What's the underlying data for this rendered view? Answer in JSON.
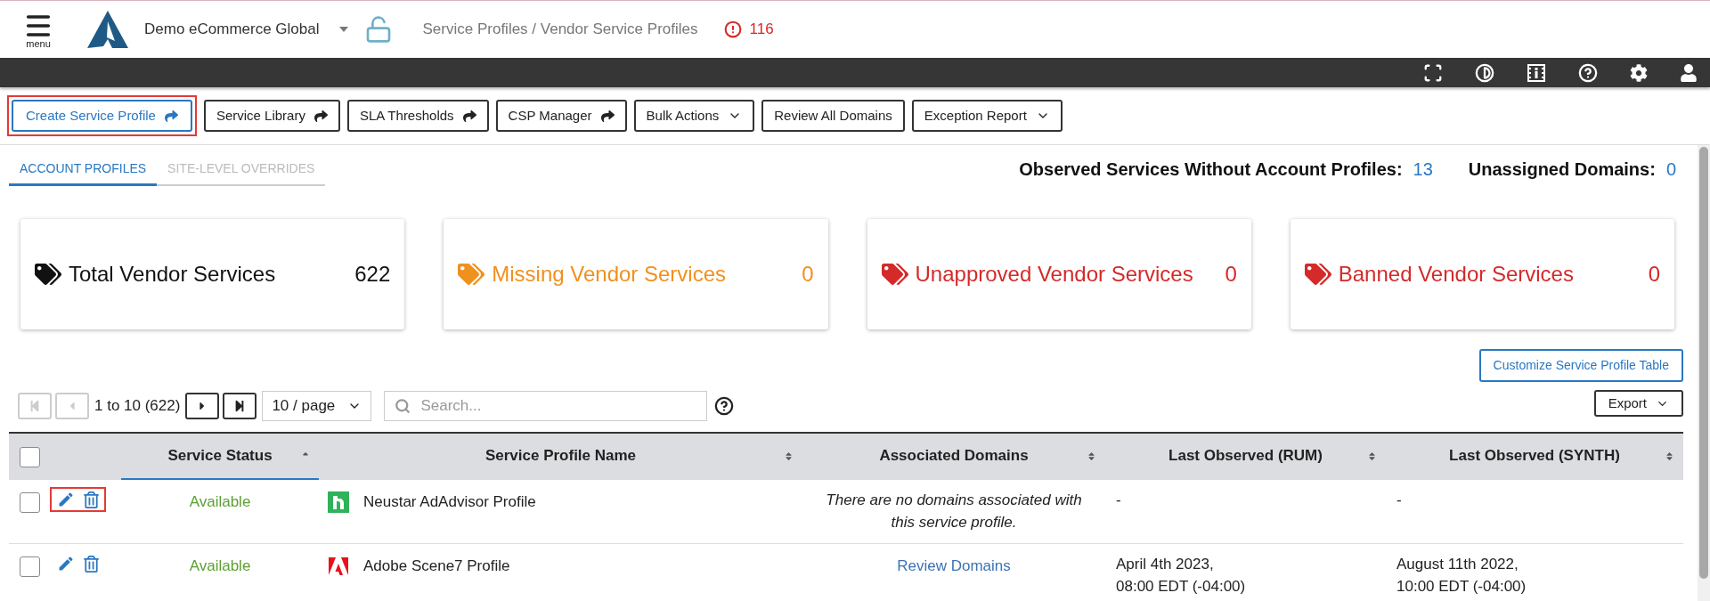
{
  "header": {
    "menu_label": "menu",
    "org_name": "Demo eCommerce Global",
    "breadcrumb": "Service Profiles / Vendor Service Profiles",
    "alert_count": "116"
  },
  "toolbar": [
    {
      "label": "Create Service Profile",
      "kind": "link",
      "primary": true,
      "highlighted": true
    },
    {
      "label": "Service Library",
      "kind": "link",
      "primary": false,
      "highlighted": false
    },
    {
      "label": "SLA Thresholds",
      "kind": "link",
      "primary": false,
      "highlighted": false
    },
    {
      "label": "CSP Manager",
      "kind": "link",
      "primary": false,
      "highlighted": false
    },
    {
      "label": "Bulk Actions",
      "kind": "dropdown",
      "primary": false,
      "highlighted": false
    },
    {
      "label": "Review All Domains",
      "kind": "plain",
      "primary": false,
      "highlighted": false
    },
    {
      "label": "Exception Report",
      "kind": "dropdown",
      "primary": false,
      "highlighted": false
    }
  ],
  "tabs": [
    {
      "label": "ACCOUNT PROFILES",
      "selected": true
    },
    {
      "label": "SITE-LEVEL OVERRIDES",
      "selected": false
    }
  ],
  "summary": [
    {
      "label": "Observed Services Without Account Profiles:",
      "value": "13"
    },
    {
      "label": "Unassigned Domains:",
      "value": "0"
    }
  ],
  "cards": [
    {
      "label": "Total Vendor Services",
      "value": "622",
      "color": "#111111"
    },
    {
      "label": "Missing Vendor Services",
      "value": "0",
      "color": "#f0901e"
    },
    {
      "label": "Unapproved Vendor Services",
      "value": "0",
      "color": "#d42a2a"
    },
    {
      "label": "Banned Vendor Services",
      "value": "0",
      "color": "#d42a2a"
    }
  ],
  "customize_button": "Customize Service Profile Table",
  "pagination": {
    "nav": [
      {
        "kind": "first",
        "disabled": true
      },
      {
        "kind": "prev",
        "disabled": true
      },
      {
        "kind": "next",
        "disabled": false
      },
      {
        "kind": "last",
        "disabled": false
      }
    ],
    "range": "1 to 10 (622)",
    "page_size": "10 / page"
  },
  "search": {
    "placeholder": "Search..."
  },
  "export_button": "Export",
  "table": {
    "select_all_checked": false,
    "columns": [
      {
        "label": "Service Status",
        "kind": "ascending"
      },
      {
        "label": "Service Profile Name",
        "kind": "sortable"
      },
      {
        "label": "Associated Domains",
        "kind": "sortable"
      },
      {
        "label": "Last Observed (RUM)",
        "kind": "sortable"
      },
      {
        "label": "Last Observed (SYNTH)",
        "kind": "sortable"
      }
    ],
    "rows": [
      {
        "checked": false,
        "actions_highlighted": true,
        "status": "Available",
        "logo": {
          "kind": "neustar"
        },
        "name": "Neustar AdAdvisor Profile",
        "domains": {
          "kind": "note",
          "text": "There are no domains associated with this service profile."
        },
        "rum": "-",
        "synth": "-"
      },
      {
        "checked": false,
        "actions_highlighted": false,
        "status": "Available",
        "logo": {
          "kind": "adobe"
        },
        "name": "Adobe Scene7 Profile",
        "domains": {
          "kind": "link",
          "text": "Review Domains"
        },
        "rum": "April 4th 2023,\n08:00 EDT (-04:00)",
        "synth": "August 11th 2022,\n10:00 EDT (-04:00)"
      }
    ]
  }
}
